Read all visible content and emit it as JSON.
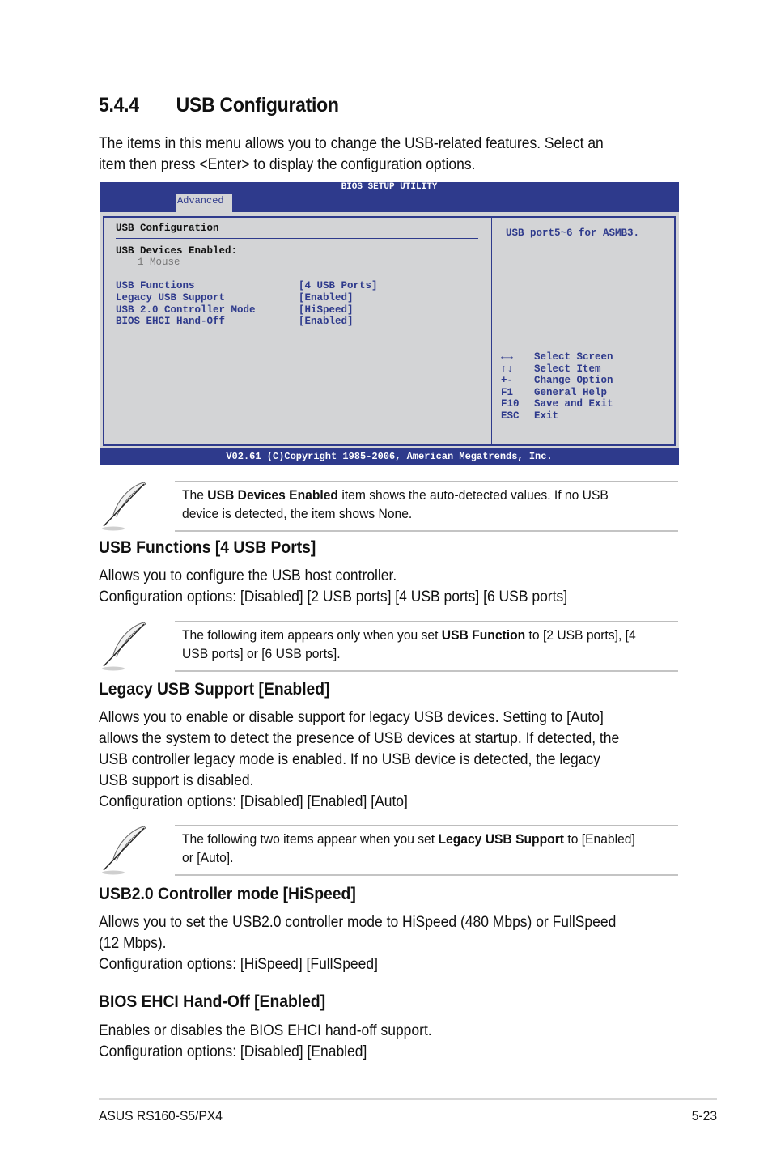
{
  "section": {
    "number": "5.4.4",
    "title": "USB Configuration",
    "intro_line1": "The items in this menu allows you to change the USB-related features. Select an",
    "intro_line2": "item then press <Enter> to display the configuration options."
  },
  "bios": {
    "title": "BIOS SETUP UTILITY",
    "active_tab": "Advanced",
    "panel_title": "USB Configuration",
    "devices_label": "USB Devices Enabled:",
    "devices_value": "1 Mouse",
    "items": [
      {
        "label": "USB Functions",
        "value": "[4 USB Ports]"
      },
      {
        "label": "Legacy USB Support",
        "value": "[Enabled]"
      },
      {
        "label": "USB 2.0 Controller Mode",
        "value": "[HiSpeed]"
      },
      {
        "label": "BIOS EHCI Hand-Off",
        "value": "[Enabled]"
      }
    ],
    "help_text": "USB port5~6 for ASMB3.",
    "keys": [
      {
        "key": "←→",
        "action": "Select Screen"
      },
      {
        "key": "↑↓",
        "action": "Select Item"
      },
      {
        "key": "+-",
        "action": "Change Option"
      },
      {
        "key": "F1",
        "action": "General Help"
      },
      {
        "key": "F10",
        "action": "Save and Exit"
      },
      {
        "key": "ESC",
        "action": "Exit"
      }
    ],
    "copyright": "V02.61 (C)Copyright 1985-2006, American Megatrends, Inc."
  },
  "notes": [
    {
      "pre": "The ",
      "bold": "USB Devices Enabled",
      "post": " item shows the auto-detected values. If no USB",
      "line2": "device is detected, the item shows None."
    },
    {
      "pre": "The following item appears only when you set ",
      "bold": "USB Function",
      "post": " to [2 USB ports], [4",
      "line2": "USB ports] or [6 USB ports]."
    },
    {
      "pre": "The following two items appear when you set ",
      "bold": "Legacy USB Support",
      "post": " to [Enabled]",
      "line2": "or [Auto]."
    }
  ],
  "subsections": [
    {
      "title": "USB Functions [4 USB Ports]",
      "lines": [
        "Allows you to configure the USB host controller.",
        "Configuration options: [Disabled] [2 USB ports] [4 USB ports] [6 USB ports]"
      ]
    },
    {
      "title": "Legacy USB Support [Enabled]",
      "lines": [
        "Allows you to enable or disable support for legacy USB devices. Setting to [Auto]",
        "allows the system to detect the presence of USB devices at startup. If detected, the",
        "USB controller legacy mode is enabled. If no USB device is detected, the legacy",
        "USB support is disabled.",
        "Configuration options: [Disabled] [Enabled] [Auto]"
      ]
    },
    {
      "title": "USB2.0 Controller mode [HiSpeed]",
      "lines": [
        "Allows you to set the USB2.0 controller mode to HiSpeed (480 Mbps) or FullSpeed",
        "(12 Mbps).",
        "Configuration options: [HiSpeed] [FullSpeed]"
      ]
    },
    {
      "title": "BIOS EHCI Hand-Off [Enabled]",
      "lines": [
        "Enables or disables the BIOS EHCI hand-off support.",
        "Configuration options: [Disabled] [Enabled]"
      ]
    }
  ],
  "footer": {
    "product": "ASUS RS160-S5/PX4",
    "page": "5-23"
  }
}
